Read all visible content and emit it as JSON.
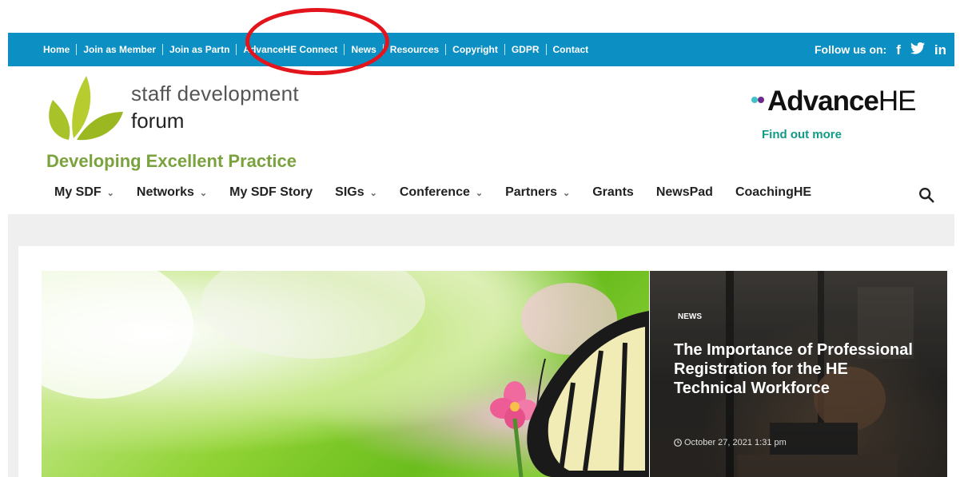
{
  "topbar": {
    "links": [
      "Home",
      "Join as Member",
      "Join as Partn",
      "AdvanceHE Connect",
      "News",
      "Resources",
      "Copyright",
      "GDPR",
      "Contact"
    ],
    "follow_label": "Follow us on:",
    "social": [
      "f",
      "…",
      "in"
    ]
  },
  "brand": {
    "line1": "staff development",
    "line2": "forum",
    "tagline": "Developing Excellent Practice"
  },
  "advance": {
    "bold": "Advance",
    "thin": "HE",
    "find_more": "Find out more"
  },
  "nav": {
    "items": [
      {
        "label": "My SDF",
        "caret": "⌄"
      },
      {
        "label": "Networks",
        "caret": "⌄"
      },
      {
        "label": "My SDF Story",
        "caret": ""
      },
      {
        "label": "SIGs",
        "caret": "⌄"
      },
      {
        "label": "Conference",
        "caret": "⌄"
      },
      {
        "label": "Partners",
        "caret": "⌄"
      },
      {
        "label": "Grants",
        "caret": ""
      },
      {
        "label": "NewsPad",
        "caret": ""
      },
      {
        "label": "CoachingHE",
        "caret": ""
      }
    ]
  },
  "feature": {
    "tag": "NEWS",
    "headline": "The Importance of Professional Registration for the HE Technical Workforce",
    "date": "October 27, 2021 1:31 pm"
  },
  "colors": {
    "topbar": "#0c8fc3",
    "annotation": "#e3141c",
    "tagline": "#7aa23d",
    "find_more": "#119a86"
  }
}
